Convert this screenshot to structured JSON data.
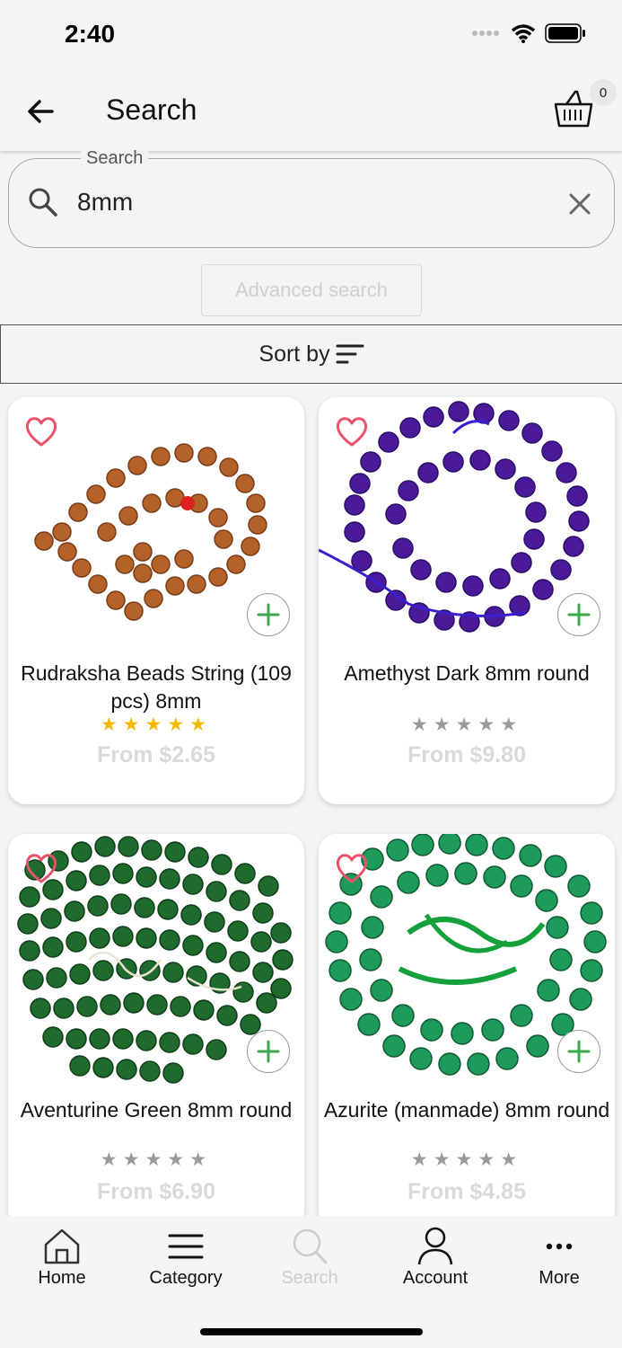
{
  "status_bar": {
    "time": "2:40"
  },
  "header": {
    "title": "Search",
    "cart_count": "0"
  },
  "search": {
    "label": "Search",
    "value": "8mm"
  },
  "advanced_search_label": "Advanced search",
  "sort": {
    "label": "Sort by"
  },
  "colors": {
    "accent_green": "#3aaa4a",
    "heart_pink": "#e8526a",
    "star_gold": "#f5b800",
    "star_gray": "#9a9a9a"
  },
  "products": [
    {
      "name": "Rudraksha Beads String (109 pcs) 8mm",
      "price": "From $2.65",
      "rating": 5
    },
    {
      "name": "Amethyst Dark 8mm round",
      "price": "From $9.80",
      "rating": 0
    },
    {
      "name": "Aventurine Green 8mm round",
      "price": "From $6.90",
      "rating": 0
    },
    {
      "name": "Azurite (manmade) 8mm round",
      "price": "From $4.85",
      "rating": 0
    }
  ],
  "bottom_nav": {
    "home": "Home",
    "category": "Category",
    "search": "Search",
    "account": "Account",
    "more": "More"
  }
}
